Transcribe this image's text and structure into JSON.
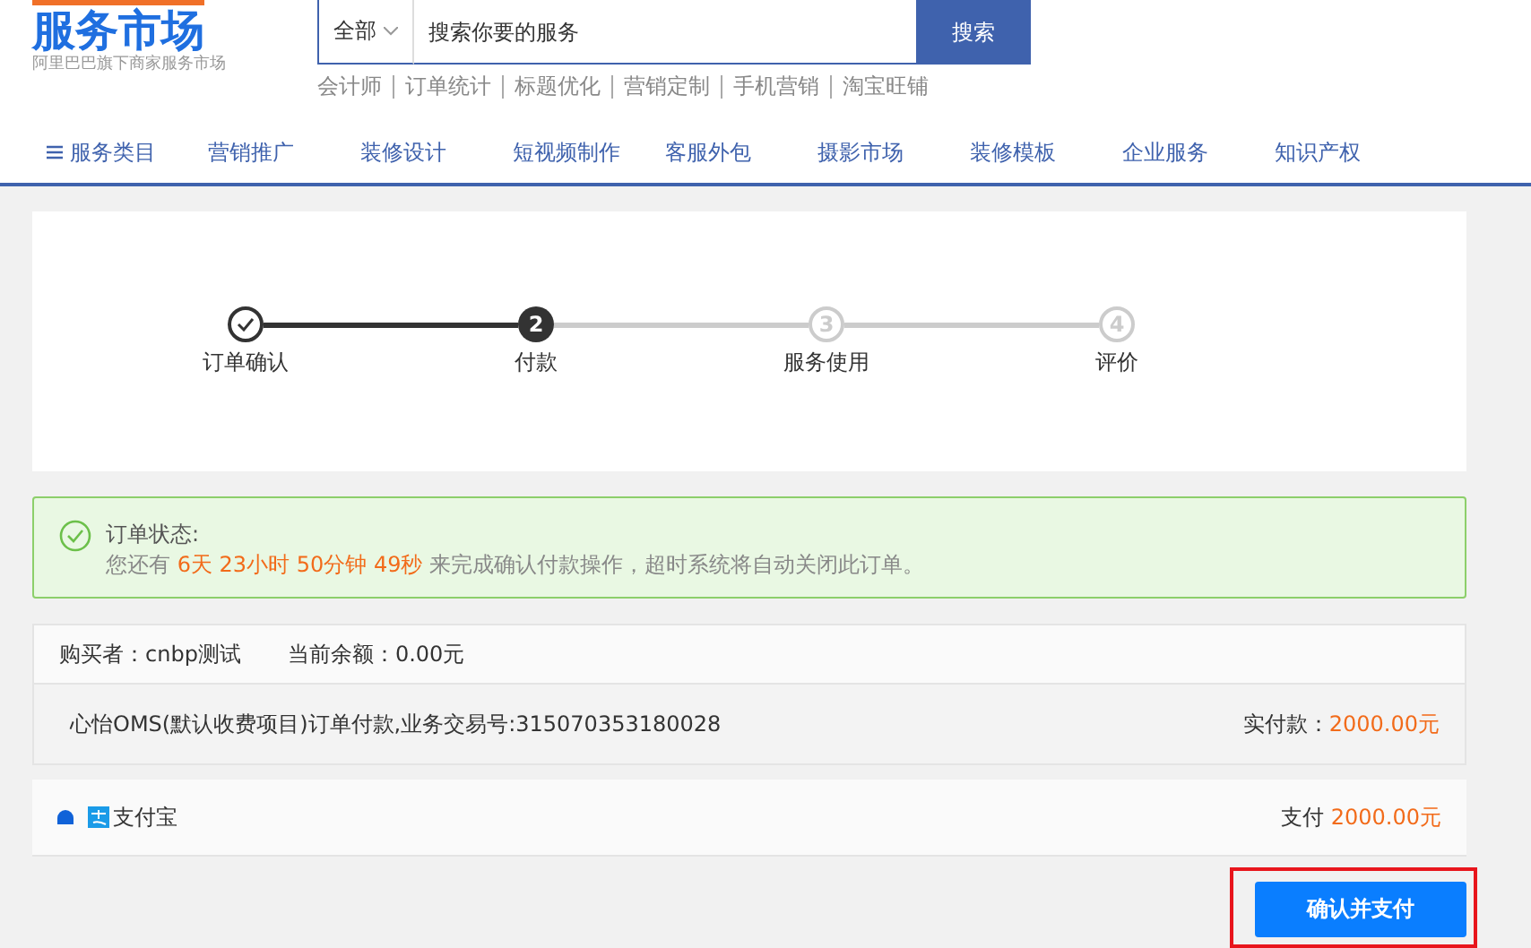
{
  "logo": {
    "title": "服务市场",
    "subtitle": "阿里巴巴旗下商家服务市场"
  },
  "search": {
    "scope": "全部",
    "placeholder": "搜索你要的服务",
    "button": "搜索"
  },
  "hot_links": [
    "会计师",
    "订单统计",
    "标题优化",
    "营销定制",
    "手机营销",
    "淘宝旺铺"
  ],
  "nav": [
    {
      "label": "服务类目",
      "kind": "menu"
    },
    {
      "label": "营销推广",
      "kind": "link"
    },
    {
      "label": "装修设计",
      "kind": "link"
    },
    {
      "label": "短视频制作",
      "kind": "link"
    },
    {
      "label": "客服外包",
      "kind": "link"
    },
    {
      "label": "摄影市场",
      "kind": "link"
    },
    {
      "label": "装修模板",
      "kind": "link"
    },
    {
      "label": "企业服务",
      "kind": "link"
    },
    {
      "label": "知识产权",
      "kind": "link"
    }
  ],
  "steps": [
    {
      "label": "订单确认",
      "completed": true,
      "selected": false
    },
    {
      "number": "2",
      "label": "付款",
      "completed": false,
      "selected": true
    },
    {
      "number": "3",
      "label": "服务使用",
      "completed": false,
      "selected": false
    },
    {
      "number": "4",
      "label": "评价",
      "completed": false,
      "selected": false
    }
  ],
  "alert": {
    "title": "订单状态:",
    "prefix": "您还有",
    "countdown": "6天 23小时 50分钟 49秒",
    "suffix": "来完成确认付款操作，超时系统将自动关闭此订单。"
  },
  "buyer": {
    "buyer": "购买者：cnbp测试",
    "balance": "当前余额：0.00元"
  },
  "order": {
    "description": "心怡OMS(默认收费项目)订单付款,业务交易号:315070353180028",
    "amount_label": "实付款：",
    "amount": "2000.00元"
  },
  "payment": {
    "method": "支付宝",
    "selected": true,
    "pay_label": "支付",
    "amount": "2000.00元"
  },
  "confirm_button": "确认并支付"
}
